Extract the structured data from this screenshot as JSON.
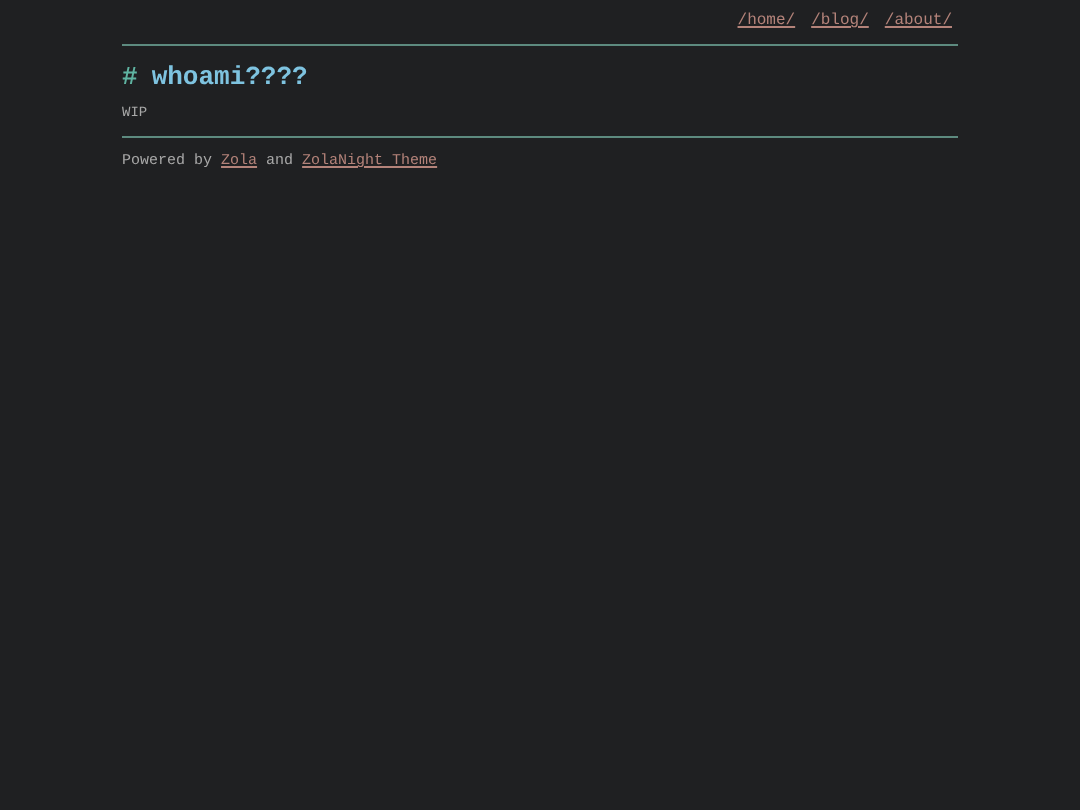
{
  "nav": [
    {
      "label": "/home/"
    },
    {
      "label": "/blog/"
    },
    {
      "label": "/about/"
    }
  ],
  "title": {
    "mark": "#",
    "text": "whoami????"
  },
  "body": "WIP",
  "footer": {
    "parts": [
      {
        "kind": "text",
        "text": "Powered by "
      },
      {
        "kind": "link",
        "text": "Zola"
      },
      {
        "kind": "text",
        "text": " and "
      },
      {
        "kind": "link",
        "text": "ZolaNight Theme"
      }
    ]
  }
}
